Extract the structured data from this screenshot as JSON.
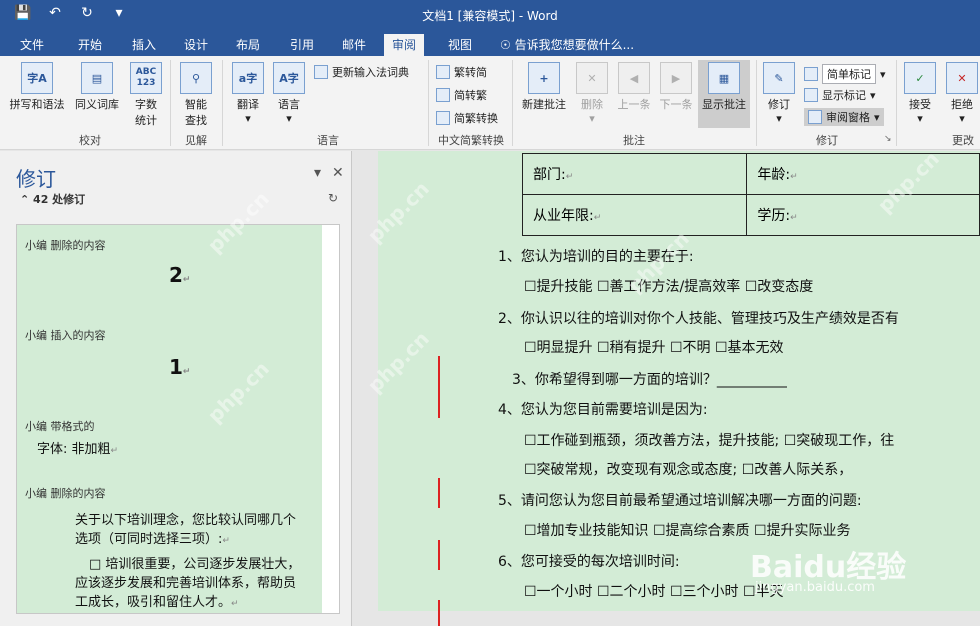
{
  "title_bar": {
    "document_title": "文档1 [兼容模式] - Word"
  },
  "tabs": [
    "文件",
    "开始",
    "插入",
    "设计",
    "布局",
    "引用",
    "邮件",
    "审阅",
    "视图"
  ],
  "active_tab": "审阅",
  "tell_me": "告诉我您想要做什么...",
  "ribbon": {
    "spelling": "拼写和语法",
    "thesaurus": "同义词库",
    "wordcount": [
      "字数",
      "统计"
    ],
    "smart_lookup": [
      "智能",
      "查找"
    ],
    "translate": "翻译",
    "language": "语言",
    "update_ime": "更新输入法词典",
    "to_traditional": "繁转简",
    "to_simplified": "简转繁",
    "convert": "简繁转换",
    "new_comment": "新建批注",
    "delete": "删除",
    "prev": "上一条",
    "next": "下一条",
    "show_comments": "显示批注",
    "track_changes": "修订",
    "simple_markup": "简单标记",
    "show_markup": "显示标记",
    "reviewing_pane": "审阅窗格",
    "accept": "接受",
    "reject": "拒绝",
    "groups": {
      "proofing": "校对",
      "insights": "见解",
      "language": "语言",
      "chinese_conversion": "中文简繁转换",
      "comments": "批注",
      "tracking": "修订",
      "changes": "更改"
    },
    "abc_label": "ABC",
    "num_label": "123"
  },
  "pane": {
    "title": "修订",
    "count": "42 处修订",
    "revisions": [
      {
        "header": "小编  删除的内容",
        "content": "2"
      },
      {
        "header": "小编  插入的内容",
        "content": "1"
      },
      {
        "header": "小编  带格式的",
        "content": "字体: 非加粗"
      },
      {
        "header": "小编  删除的内容",
        "content": "关于以下培训理念，您比较认同哪几个选项（可同时选择三项）:"
      }
    ],
    "sub_lines": [
      "关于以下培训理念，您比较认同哪几个",
      "选项（可同时选择三项）:"
    ],
    "bullet_lines": [
      "□  培训很重要，公司逐步发展壮大，",
      "应该逐步发展和完善培训体系，帮助员",
      "工成长，吸引和留住人才。"
    ]
  },
  "document": {
    "table": [
      [
        "部门:",
        "年龄:"
      ],
      [
        "从业年限:",
        "学历:"
      ]
    ],
    "questions": [
      "1、您认为培训的目的主要在于:",
      "☐提升技能         ☐善工作方法/提高效率       ☐改变态度",
      "2、你认识以往的培训对你个人技能、管理技巧及生产绩效是否有",
      "☐明显提升          ☐稍有提升              ☐不明              ☐基本无效",
      "3、你希望得到哪一方面的培训？__________",
      "4、您认为您目前需要培训是因为:",
      "☐工作碰到瓶颈，须改善方法，提升技能;    ☐突破现工作，往",
      "☐突破常规，改变现有观念或态度;              ☐改善人际关系，",
      "5、请问您认为您目前最希望通过培训解决哪一方面的问题:",
      "☐增加专业技能知识      ☐提高综合素质        ☐提升实际业务",
      "6、您可接受的每次培训时间:",
      "☐一个小时          ☐二个小时          ☐三个小时          ☐半天"
    ]
  },
  "watermarks": {
    "site": "php.cn",
    "baidu": "Baidu经验",
    "baidu_sub": "jingyan.baidu.com"
  }
}
